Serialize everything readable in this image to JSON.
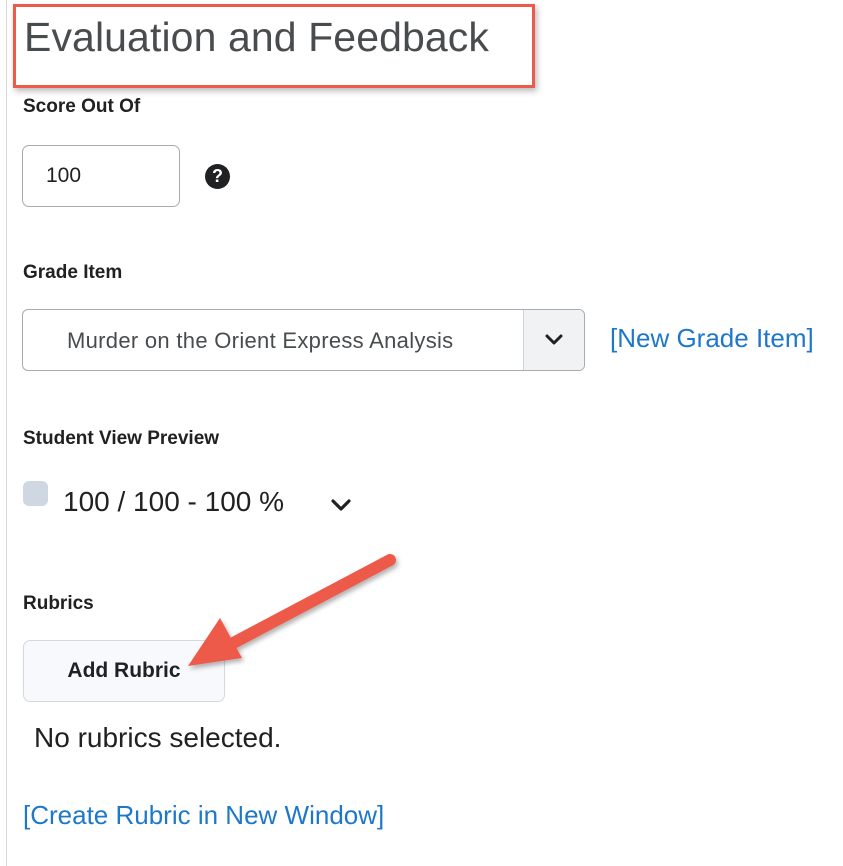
{
  "title": "Evaluation and Feedback",
  "score": {
    "label": "Score Out Of",
    "value": "100",
    "help_icon": "question-circle-icon"
  },
  "grade_item": {
    "label": "Grade Item",
    "selected": "Murder on the Orient Express Analysis",
    "dropdown_icon": "chevron-down-icon",
    "new_link": "[New Grade Item]"
  },
  "preview": {
    "label": "Student View Preview",
    "value": "100 / 100 - 100 %",
    "expand_icon": "chevron-down-icon"
  },
  "rubrics": {
    "label": "Rubrics",
    "add_button": "Add Rubric",
    "empty_text": "No rubrics selected.",
    "create_link": "[Create Rubric in New Window]"
  },
  "colors": {
    "accent_link": "#1e78c9",
    "highlight": "#ee5a4a",
    "swatch": "#cfd7e3"
  }
}
